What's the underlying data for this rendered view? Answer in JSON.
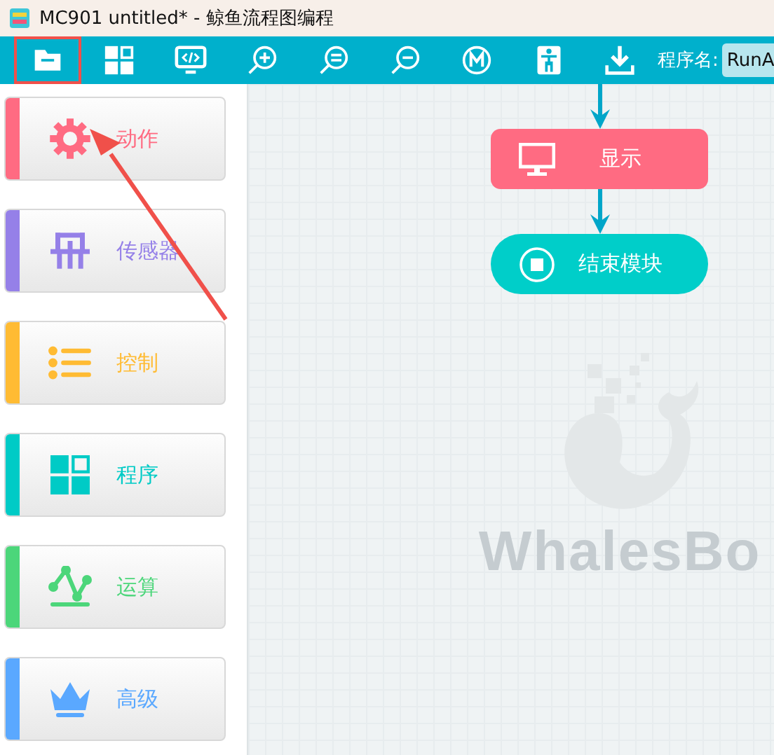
{
  "window": {
    "title": "MC901 untitled* - 鲸鱼流程图编程"
  },
  "toolbar": {
    "buttons": [
      {
        "kind": "folder",
        "highlighted": true
      },
      {
        "kind": "grid",
        "highlighted": false
      },
      {
        "kind": "code",
        "highlighted": false
      },
      {
        "kind": "zoom-in",
        "highlighted": false
      },
      {
        "kind": "zoom-fit",
        "highlighted": false
      },
      {
        "kind": "zoom-out",
        "highlighted": false
      },
      {
        "kind": "m",
        "highlighted": false
      },
      {
        "kind": "robot",
        "highlighted": false
      },
      {
        "kind": "download",
        "highlighted": false
      }
    ],
    "program_name": {
      "label": "程序名:",
      "value": "RunA"
    }
  },
  "categories": [
    {
      "kind": "gear",
      "label": "动作",
      "color": "#ff6b82"
    },
    {
      "kind": "sensor",
      "label": "传感器",
      "color": "#9580e8"
    },
    {
      "kind": "list",
      "label": "控制",
      "color": "#ffbb33"
    },
    {
      "kind": "blocks",
      "label": "程序",
      "color": "#00cbc6"
    },
    {
      "kind": "graph",
      "label": "运算",
      "color": "#4cd67a"
    },
    {
      "kind": "crown",
      "label": "高级",
      "color": "#5aa8ff"
    }
  ],
  "flow": {
    "blocks": [
      {
        "kind": "display",
        "label": "显示"
      },
      {
        "kind": "end",
        "label": "结束模块"
      }
    ]
  },
  "canvas_logo": {
    "text": "WhalesBo"
  }
}
